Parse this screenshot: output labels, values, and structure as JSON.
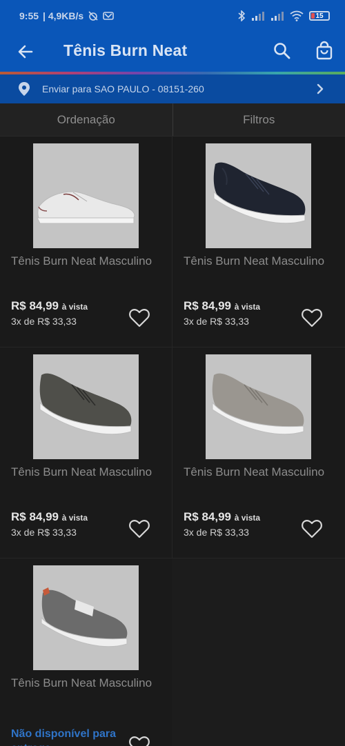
{
  "status_bar": {
    "time": "9:55",
    "speed": "| 4,9KB/s",
    "battery": "15"
  },
  "app_bar": {
    "title": "Tênis Burn Neat"
  },
  "shipping": {
    "label": "Enviar para SAO PAULO - 08151-260"
  },
  "sort_bar": {
    "sort_label": "Ordenação",
    "filter_label": "Filtros"
  },
  "products": [
    {
      "name": "Tênis Burn Neat Masculino",
      "price": "R$ 84,99",
      "price_suffix": "à vista",
      "installments": "3x de R$ 33,33",
      "color": "white"
    },
    {
      "name": "Tênis Burn Neat Masculino",
      "price": "R$ 84,99",
      "price_suffix": "à vista",
      "installments": "3x de R$ 33,33",
      "color": "navy"
    },
    {
      "name": "Tênis Burn Neat Masculino",
      "price": "R$ 84,99",
      "price_suffix": "à vista",
      "installments": "3x de R$ 33,33",
      "color": "dark-gray"
    },
    {
      "name": "Tênis Burn Neat Masculino",
      "price": "R$ 84,99",
      "price_suffix": "à vista",
      "installments": "3x de R$ 33,33",
      "color": "light-gray"
    },
    {
      "name": "Tênis Burn Neat Masculino",
      "unavailable": "Não disponível para entrega",
      "color": "gray"
    }
  ]
}
